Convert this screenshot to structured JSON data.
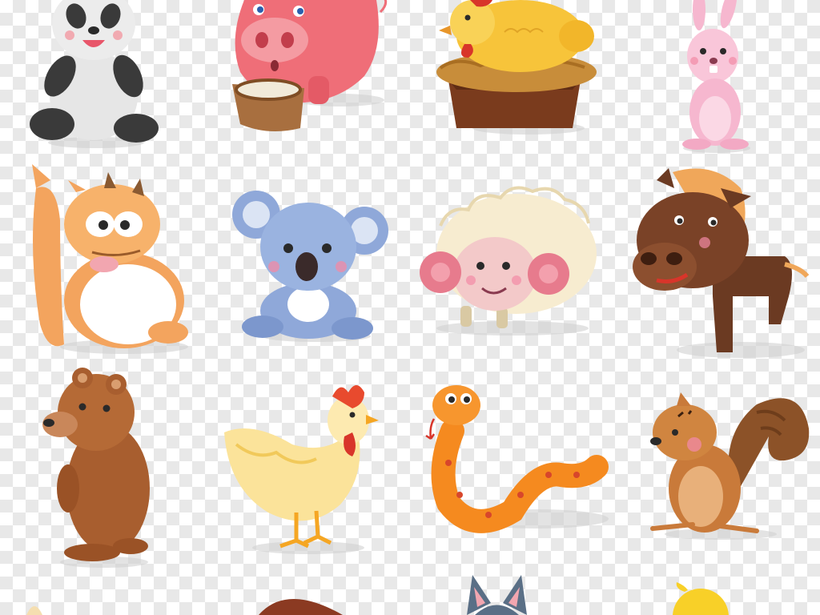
{
  "canvas": {
    "pattern": "transparency-checkerboard",
    "light": "#ffffff",
    "dark": "#e8e8e8"
  },
  "animals": [
    {
      "name": "panda",
      "icon": "panda-icon",
      "colors": {
        "body": "#e6e6e6",
        "dark": "#3a3a3a"
      }
    },
    {
      "name": "pig",
      "icon": "pig-icon",
      "colors": {
        "body": "#ef6e78",
        "snout": "#f49ba2",
        "trough": "#a86f3f"
      }
    },
    {
      "name": "hen-in-nest",
      "icon": "hen-nest-icon",
      "colors": {
        "body": "#f7c43a",
        "nest": "#c88d3a",
        "box": "#7a3b1d"
      }
    },
    {
      "name": "rabbit",
      "icon": "rabbit-icon",
      "colors": {
        "body": "#f6b7cf"
      }
    },
    {
      "name": "squirrel-cartoon",
      "icon": "squirrel-cartoon-icon",
      "colors": {
        "body": "#f3a45e",
        "belly": "#ffffff"
      }
    },
    {
      "name": "koala",
      "icon": "koala-icon",
      "colors": {
        "body": "#8fa8d9",
        "nose": "#3a2a2a"
      }
    },
    {
      "name": "sheep",
      "icon": "sheep-icon",
      "colors": {
        "wool": "#f7ecd0",
        "face": "#f3c9c9",
        "horn": "#e77b8d"
      }
    },
    {
      "name": "horse",
      "icon": "horse-icon",
      "colors": {
        "body": "#6b3a22",
        "mane": "#f0a75a"
      }
    },
    {
      "name": "bear",
      "icon": "bear-icon",
      "colors": {
        "body": "#a85e2f"
      }
    },
    {
      "name": "chicken",
      "icon": "chicken-icon",
      "colors": {
        "body": "#fbe39a",
        "comb": "#e84a2e"
      }
    },
    {
      "name": "snake",
      "icon": "snake-icon",
      "colors": {
        "body": "#f58a1f",
        "spots": "#d8462b"
      }
    },
    {
      "name": "chipmunk",
      "icon": "chipmunk-icon",
      "colors": {
        "body": "#c97a3a",
        "tail": "#8c5228"
      }
    },
    {
      "name": "brown-animal-partial",
      "icon": "brown-animal-icon",
      "colors": {
        "body": "#8b3a22"
      }
    },
    {
      "name": "cat-ears-partial",
      "icon": "cat-ears-icon",
      "colors": {
        "body": "#5a6f86"
      }
    },
    {
      "name": "chick-partial",
      "icon": "chick-icon",
      "colors": {
        "body": "#f8d028"
      }
    }
  ]
}
